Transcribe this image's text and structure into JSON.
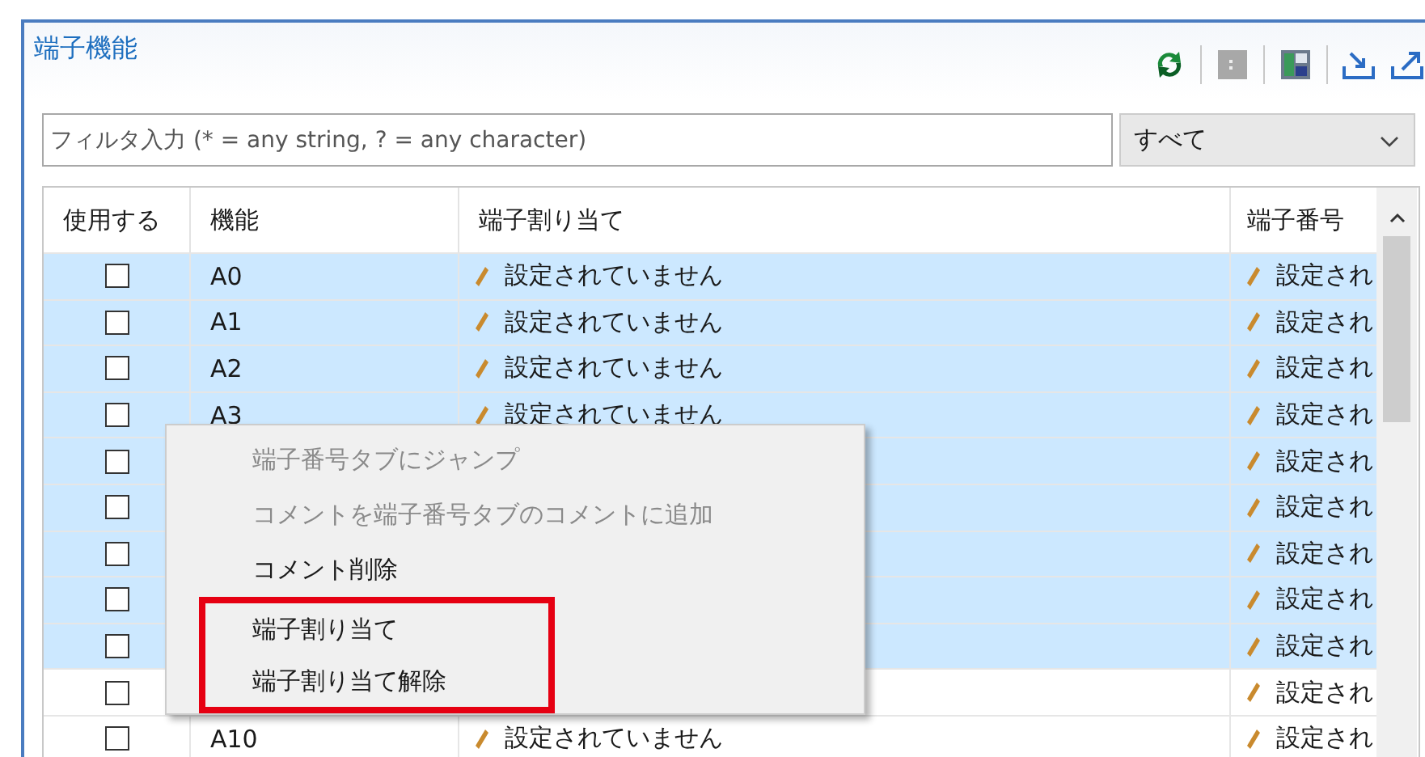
{
  "panel": {
    "title": "端子機能"
  },
  "filter": {
    "placeholder": "フィルタ入力 (* = any string, ? = any character)"
  },
  "dropdown": {
    "value": "すべて"
  },
  "table": {
    "columns": [
      "使用する",
      "機能",
      "端子割り当て",
      "端子番号"
    ],
    "rows": [
      {
        "checked": false,
        "selected": true,
        "name": "A0",
        "assignment": "設定されていません",
        "pin": "設定され"
      },
      {
        "checked": false,
        "selected": true,
        "name": "A1",
        "assignment": "設定されていません",
        "pin": "設定され"
      },
      {
        "checked": false,
        "selected": true,
        "name": "A2",
        "assignment": "設定されていません",
        "pin": "設定され"
      },
      {
        "checked": false,
        "selected": true,
        "name": "A3",
        "assignment": "設定されていません",
        "pin": "設定され"
      },
      {
        "checked": false,
        "selected": true,
        "pin": "設定され"
      },
      {
        "checked": false,
        "selected": true,
        "pin": "設定され"
      },
      {
        "checked": false,
        "selected": true,
        "pin": "設定され"
      },
      {
        "checked": false,
        "selected": true,
        "pin": "設定され"
      },
      {
        "checked": false,
        "selected": true,
        "pin": "設定され"
      },
      {
        "checked": false,
        "selected": false,
        "pin": "設定され"
      },
      {
        "checked": false,
        "selected": false,
        "name": "A10",
        "assignment": "設定されていません",
        "pin": "設定され"
      }
    ]
  },
  "context_menu": {
    "items": [
      {
        "label": "端子番号タブにジャンプ",
        "disabled": true,
        "highlighted": false
      },
      {
        "label": "コメントを端子番号タブのコメントに追加",
        "disabled": true,
        "highlighted": false
      },
      {
        "label": "コメント削除",
        "disabled": false,
        "highlighted": false
      },
      {
        "label": "端子割り当て",
        "disabled": false,
        "highlighted": true
      },
      {
        "label": "端子割り当て解除",
        "disabled": false,
        "highlighted": true
      }
    ]
  }
}
